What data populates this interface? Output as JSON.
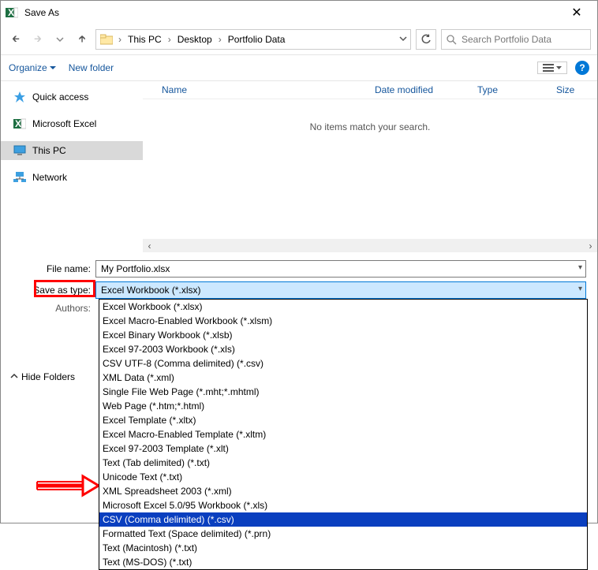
{
  "window": {
    "title": "Save As"
  },
  "breadcrumbs": {
    "b1": "This PC",
    "b2": "Desktop",
    "b3": "Portfolio Data"
  },
  "search": {
    "placeholder": "Search Portfolio Data"
  },
  "toolbar": {
    "organize": "Organize",
    "newfolder": "New folder"
  },
  "sidebar": {
    "quick": "Quick access",
    "excel": "Microsoft Excel",
    "thispc": "This PC",
    "network": "Network"
  },
  "columns": {
    "name": "Name",
    "date": "Date modified",
    "type": "Type",
    "size": "Size"
  },
  "content": {
    "empty": "No items match your search."
  },
  "form": {
    "filename_label": "File name:",
    "filename_value": "My Portfolio.xlsx",
    "savetype_label": "Save as type:",
    "savetype_value": "Excel Workbook (*.xlsx)",
    "authors_label": "Authors:"
  },
  "hidefolders": "Hide Folders",
  "dropdown": {
    "i0": "Excel Workbook (*.xlsx)",
    "i1": "Excel Macro-Enabled Workbook (*.xlsm)",
    "i2": "Excel Binary Workbook (*.xlsb)",
    "i3": "Excel 97-2003 Workbook (*.xls)",
    "i4": "CSV UTF-8 (Comma delimited) (*.csv)",
    "i5": "XML Data (*.xml)",
    "i6": "Single File Web Page (*.mht;*.mhtml)",
    "i7": "Web Page (*.htm;*.html)",
    "i8": "Excel Template (*.xltx)",
    "i9": "Excel Macro-Enabled Template (*.xltm)",
    "i10": "Excel 97-2003 Template (*.xlt)",
    "i11": "Text (Tab delimited) (*.txt)",
    "i12": "Unicode Text (*.txt)",
    "i13": "XML Spreadsheet 2003 (*.xml)",
    "i14": "Microsoft Excel 5.0/95 Workbook (*.xls)",
    "i15": "CSV (Comma delimited) (*.csv)",
    "i16": "Formatted Text (Space delimited) (*.prn)",
    "i17": "Text (Macintosh) (*.txt)",
    "i18": "Text (MS-DOS) (*.txt)"
  }
}
